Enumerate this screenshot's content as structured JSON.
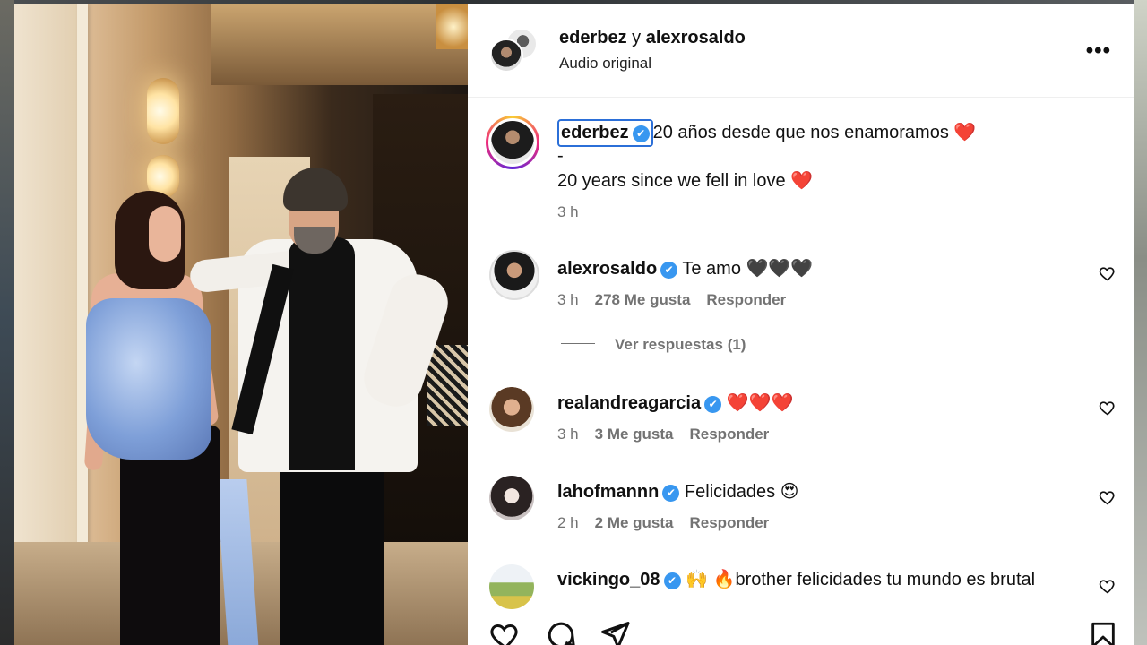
{
  "header": {
    "user1": "ederbez",
    "joiner": "y",
    "user2": "alexrosaldo",
    "subtitle": "Audio original",
    "more_label": "•••"
  },
  "caption": {
    "username": "ederbez",
    "text_es": "20 años desde que nos enamoramos",
    "separator": "-",
    "text_en": "20 years since we fell in love",
    "heart": "❤️",
    "time": "3 h"
  },
  "comments": [
    {
      "username": "alexrosaldo",
      "verified": true,
      "text": "Te amo 🖤🖤🖤",
      "time": "3 h",
      "likes": "278 Me gusta",
      "reply": "Responder"
    },
    {
      "username": "realandreagarcia",
      "verified": true,
      "text": "❤️❤️❤️",
      "time": "3 h",
      "likes": "3 Me gusta",
      "reply": "Responder"
    },
    {
      "username": "lahofmannn",
      "verified": true,
      "text": "Felicidades 😍",
      "time": "2 h",
      "likes": "2 Me gusta",
      "reply": "Responder"
    },
    {
      "username": "vickingo_08",
      "verified": true,
      "text": "🙌 🔥brother felicidades tu mundo es brutal"
    }
  ],
  "view_replies": "Ver respuestas (1)",
  "icons": {
    "verified": "✔",
    "like": "heart-icon",
    "comment": "comment-icon",
    "share": "share-icon",
    "save": "bookmark-icon"
  },
  "colors": {
    "verified": "#3897f0",
    "heart": "#e0245e",
    "muted": "#737373"
  }
}
